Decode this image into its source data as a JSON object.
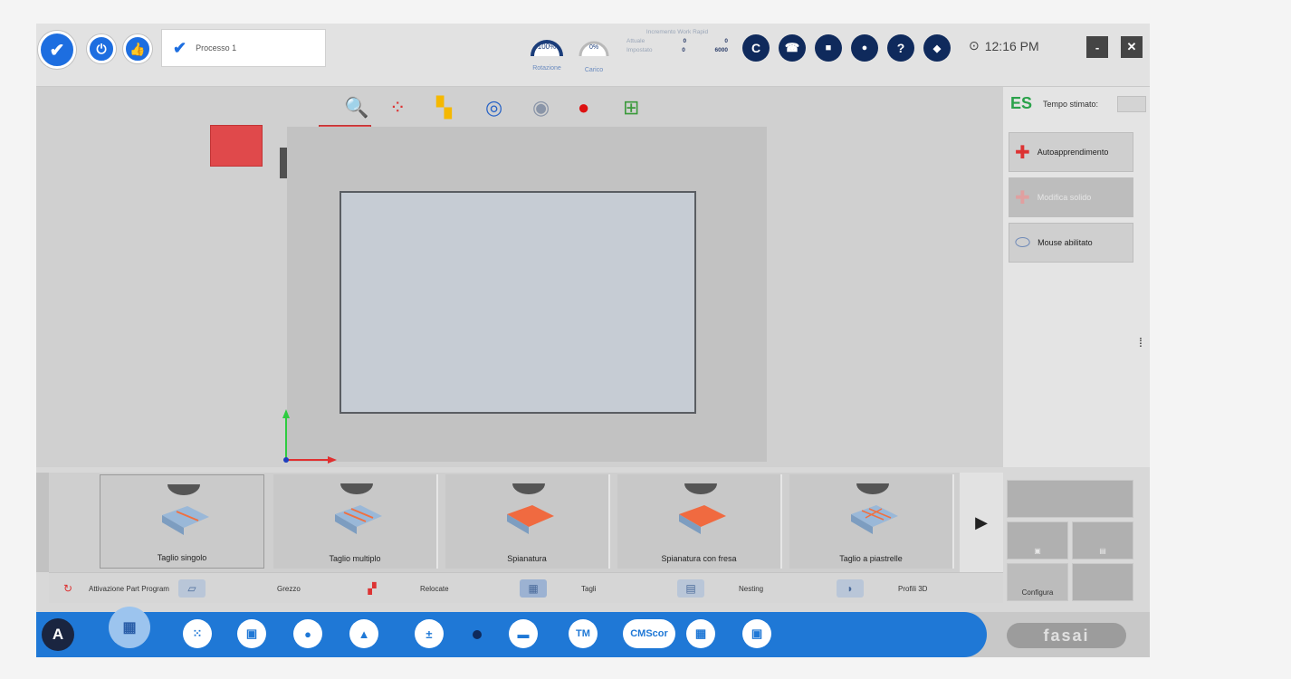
{
  "header": {
    "process_label": "Processo 1",
    "rotation": {
      "value": "100%",
      "label": "Rotazione"
    },
    "load": {
      "value": "0%",
      "label": "Carico"
    },
    "work_rapid": {
      "title": "Incremento Work Rapid",
      "actual_label": "Attuale",
      "actual_a": "0",
      "actual_b": "0",
      "set_label": "Impostato",
      "set_a": "0",
      "set_b": "6000"
    },
    "round_buttons": [
      "C",
      "☎",
      "■",
      "●",
      "?",
      "◆"
    ],
    "time": "12:16 PM"
  },
  "right_panel": {
    "es_label": "ES",
    "tempo_label": "Tempo stimato:",
    "buttons": [
      {
        "label": "Autoapprendimento",
        "disabled": false
      },
      {
        "label": "Modifica solido",
        "disabled": true
      },
      {
        "label": "Mouse abilitato",
        "disabled": false
      }
    ]
  },
  "operations": [
    {
      "label": "Taglio singolo"
    },
    {
      "label": "Taglio multiplo"
    },
    {
      "label": "Spianatura"
    },
    {
      "label": "Spianatura con fresa"
    },
    {
      "label": "Taglio a piastrelle"
    }
  ],
  "tabs": [
    {
      "label": "Attivazione Part Program"
    },
    {
      "label": "Grezzo"
    },
    {
      "label": "Relocate"
    },
    {
      "label": "Tagli"
    },
    {
      "label": "Nesting"
    },
    {
      "label": "Profili 3D"
    }
  ],
  "right_lower": {
    "configura": "Configura"
  },
  "taskbar": {
    "a_label": "A",
    "tm_label": "TM",
    "cms_label": "CMScor",
    "logo": "fasai"
  },
  "colors": {
    "accent": "#1f78d6",
    "navy": "#0f2a5c",
    "red_block": "#e0494b",
    "es_green": "#2aa24a"
  }
}
